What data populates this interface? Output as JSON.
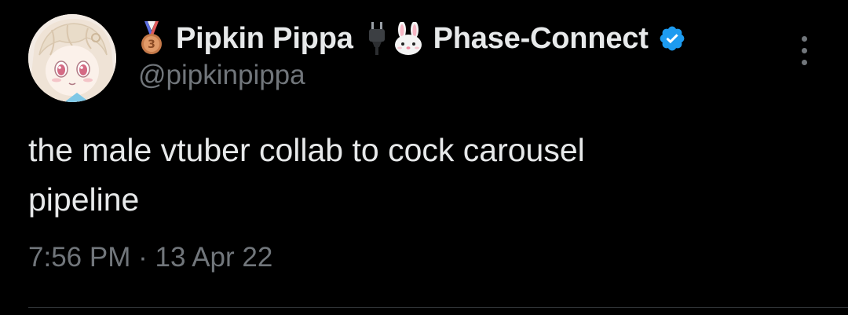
{
  "tweet": {
    "author": {
      "display_name": "Pipkin Pippa",
      "handle": "@pipkinpippa",
      "affiliation": "Phase-Connect",
      "badges": [
        "medal-icon",
        "plug-icon",
        "bunny-icon",
        "verified-badge-icon"
      ]
    },
    "text_line_1": "the male vtuber collab to cock carousel",
    "text_line_2": "pipeline",
    "time": "7:56 PM",
    "separator": "·",
    "date": "13 Apr 22"
  },
  "colors": {
    "background": "#000000",
    "primary_text": "#e7e9ea",
    "secondary_text": "#71767b",
    "verified_blue": "#1d9bf0",
    "divider": "#2f3336"
  }
}
